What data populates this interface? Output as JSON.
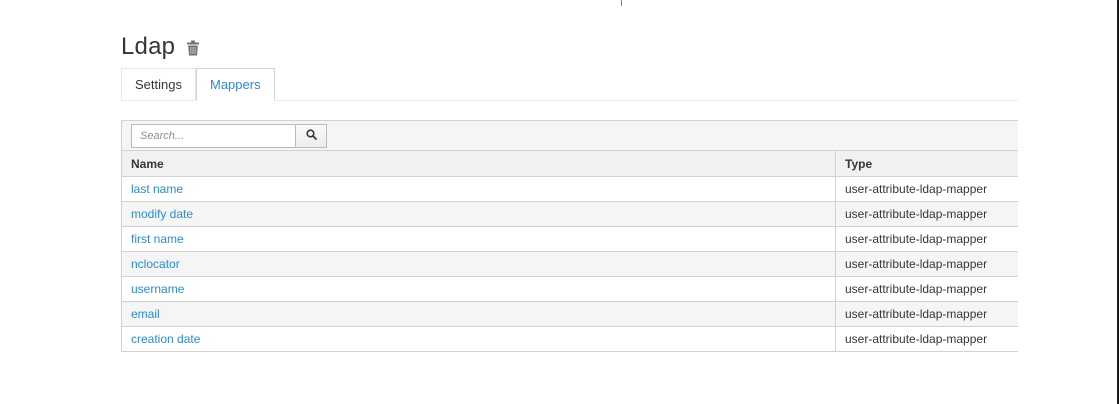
{
  "page": {
    "title": "Ldap"
  },
  "tabs": [
    {
      "label": "Settings",
      "active": false
    },
    {
      "label": "Mappers",
      "active": true
    }
  ],
  "search": {
    "placeholder": "Search...",
    "value": ""
  },
  "table": {
    "columns": {
      "name": "Name",
      "type": "Type"
    },
    "rows": [
      {
        "name": "last name",
        "type": "user-attribute-ldap-mapper"
      },
      {
        "name": "modify date",
        "type": "user-attribute-ldap-mapper"
      },
      {
        "name": "first name",
        "type": "user-attribute-ldap-mapper"
      },
      {
        "name": "nclocator",
        "type": "user-attribute-ldap-mapper"
      },
      {
        "name": "username",
        "type": "user-attribute-ldap-mapper"
      },
      {
        "name": "email",
        "type": "user-attribute-ldap-mapper"
      },
      {
        "name": "creation date",
        "type": "user-attribute-ldap-mapper"
      }
    ]
  },
  "icons": {
    "delete": "trash-icon",
    "search": "search-icon"
  },
  "colors": {
    "link": "#2b8ccb",
    "text": "#363636",
    "border": "#d1d1d1"
  }
}
